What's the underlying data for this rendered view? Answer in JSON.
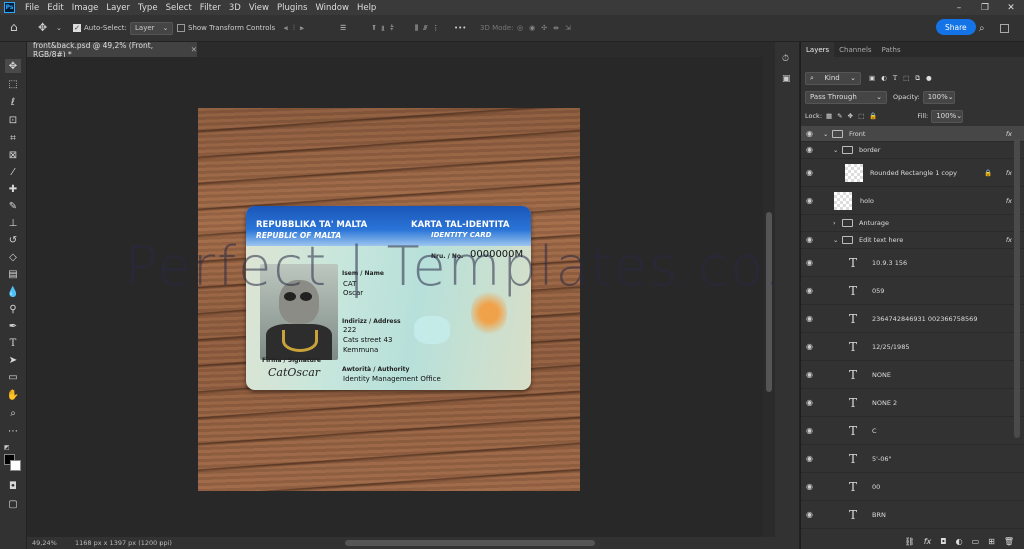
{
  "menubar": {
    "app_icon": "Ps",
    "items": [
      "File",
      "Edit",
      "Image",
      "Layer",
      "Type",
      "Select",
      "Filter",
      "3D",
      "View",
      "Plugins",
      "Window",
      "Help"
    ]
  },
  "options": {
    "auto_select_label": "Auto-Select:",
    "auto_select_value": "Layer",
    "show_transform": "Show Transform Controls",
    "mode_3d": "3D Mode:",
    "more": "•••",
    "share": "Share"
  },
  "document": {
    "tab_title": "front&back.psd @ 49,2% (Front, RGB/8#) *",
    "zoom": "49,24%",
    "dimensions": "1168 px x 1397 px (1200 ppi)"
  },
  "card": {
    "republic_mt": "REPUBBLIKA TA' MALTA",
    "republic_en": "REPUBLIC OF MALTA",
    "card_mt": "KARTA TAL-IDENTITA",
    "card_en": "IDENTITY CARD",
    "no_label": "Nru. / No.",
    "no_value": "0000000M",
    "name_label": "Isem / Name",
    "surname": "CAT",
    "given": "Oscar",
    "address_label": "Indirizz / Address",
    "addr1": "222",
    "addr2": "Cats street 43",
    "addr3": "Kemmuna",
    "sig_label": "Firma / Signature",
    "signature": "CatOscar",
    "auth_label": "Awtorità / Authority",
    "auth_value": "Identity Management Office"
  },
  "watermark": "Perfect | Templates.co.uk",
  "panel": {
    "tabs": [
      "Layers",
      "Channels",
      "Paths"
    ],
    "kind": "Kind",
    "blend": "Pass Through",
    "opacity_label": "Opacity:",
    "opacity": "100%",
    "lock_label": "Lock:",
    "fill_label": "Fill:",
    "fill": "100%",
    "layers": [
      {
        "name": "Front",
        "type": "group",
        "indent": 0,
        "fx": true
      },
      {
        "name": "border",
        "type": "group",
        "indent": 1,
        "fx": false
      },
      {
        "name": "Rounded Rectangle 1 copy",
        "type": "shape",
        "indent": 2,
        "fx": true
      },
      {
        "name": "holo",
        "type": "pixel",
        "indent": 1,
        "fx": true
      },
      {
        "name": "Anturage",
        "type": "group",
        "indent": 1,
        "fx": false
      },
      {
        "name": "Edit text here",
        "type": "group",
        "indent": 1,
        "fx": true
      },
      {
        "name": "10.9.3 156",
        "type": "text",
        "indent": 2,
        "fx": false
      },
      {
        "name": "059",
        "type": "text",
        "indent": 2,
        "fx": false
      },
      {
        "name": "2364742846931 002366758569",
        "type": "text",
        "indent": 2,
        "fx": false
      },
      {
        "name": "12/25/1985",
        "type": "text",
        "indent": 2,
        "fx": false
      },
      {
        "name": "NONE",
        "type": "text",
        "indent": 2,
        "fx": false
      },
      {
        "name": "NONE 2",
        "type": "text",
        "indent": 2,
        "fx": false
      },
      {
        "name": "C",
        "type": "text",
        "indent": 2,
        "fx": false
      },
      {
        "name": "5'-06\"",
        "type": "text",
        "indent": 2,
        "fx": false
      },
      {
        "name": "00",
        "type": "text",
        "indent": 2,
        "fx": false
      },
      {
        "name": "BRN",
        "type": "text",
        "indent": 2,
        "fx": false
      }
    ]
  }
}
